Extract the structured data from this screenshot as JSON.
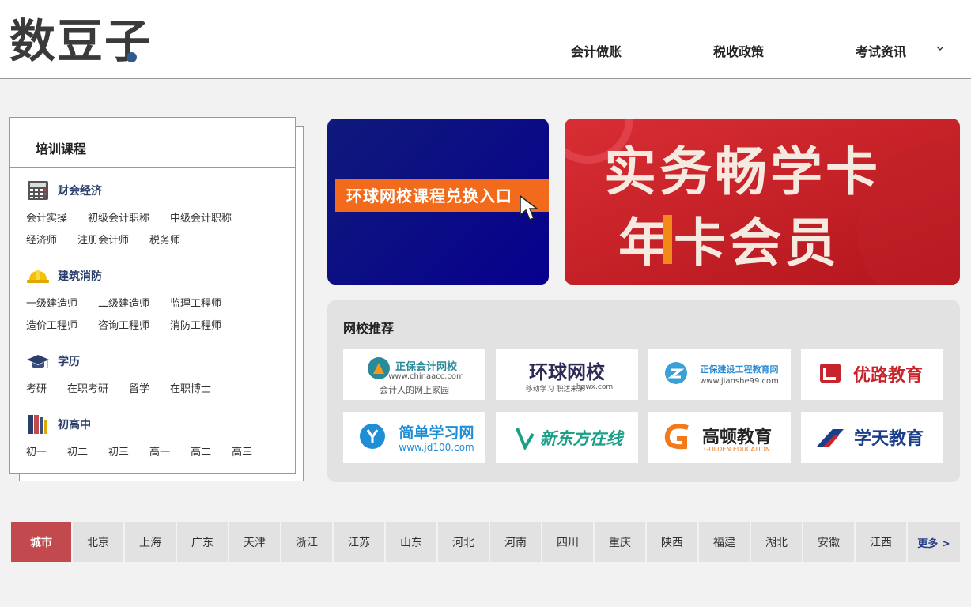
{
  "header": {
    "logo": "数豆子",
    "nav": [
      {
        "label": "会计做账"
      },
      {
        "label": "税收政策"
      },
      {
        "label": "考试资讯"
      }
    ]
  },
  "sidebar": {
    "title": "培训课程",
    "categories": [
      {
        "name": "财会经济",
        "icon": "calculator-icon",
        "links": [
          "会计实操",
          "初级会计职称",
          "中级会计职称",
          "经济师",
          "注册会计师",
          "税务师"
        ]
      },
      {
        "name": "建筑消防",
        "icon": "hardhat-icon",
        "links": [
          "一级建造师",
          "二级建造师",
          "监理工程师",
          "造价工程师",
          "咨询工程师",
          "消防工程师"
        ]
      },
      {
        "name": "学历",
        "icon": "graduation-cap-icon",
        "links": [
          "考研",
          "在职考研",
          "留学",
          "在职博士"
        ]
      },
      {
        "name": "初高中",
        "icon": "books-icon",
        "links": [
          "初一",
          "初二",
          "初三",
          "高一",
          "高二",
          "高三"
        ]
      }
    ]
  },
  "banners": {
    "left_text": "环球网校课程兑换入口",
    "right_line1": "实务畅学卡",
    "right_line2": "年卡会员"
  },
  "recommend": {
    "title": "网校推荐",
    "tiles": [
      {
        "main": "正保会计网校",
        "sub1": "www.chinaacc.com",
        "sub2": "会计人的网上家园",
        "color": "#2a8a9a"
      },
      {
        "main": "环球网校",
        "sub1": "移动学习 职达未来",
        "sub2": "hqwx.com",
        "color": "#2b2b55"
      },
      {
        "main": "正保建设工程教育网",
        "sub1": "www.jianshe99.com",
        "sub2": "",
        "color": "#2a8ad0"
      },
      {
        "main": "优路教育",
        "sub1": "",
        "sub2": "",
        "color": "#c8242b"
      },
      {
        "main": "简单学习网",
        "sub1": "www.jd100.com",
        "sub2": "",
        "color": "#1e8fd6"
      },
      {
        "main": "新东方在线",
        "sub1": "",
        "sub2": "",
        "color": "#1aa086"
      },
      {
        "main": "高顿教育",
        "sub1": "GOLDEN EDUCATION",
        "sub2": "",
        "color": "#222222"
      },
      {
        "main": "学天教育",
        "sub1": "",
        "sub2": "",
        "color": "#1a3e8a"
      }
    ]
  },
  "cities": {
    "label": "城市",
    "items": [
      "北京",
      "上海",
      "广东",
      "天津",
      "浙江",
      "江苏",
      "山东",
      "河北",
      "河南",
      "四川",
      "重庆",
      "陕西",
      "福建",
      "湖北",
      "安徽",
      "江西"
    ],
    "more": "更多 >"
  }
}
